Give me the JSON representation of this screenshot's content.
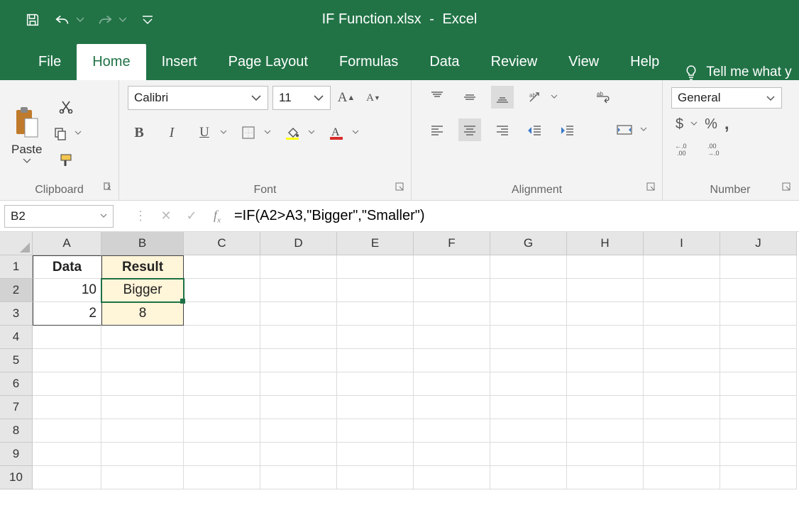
{
  "title": {
    "filename": "IF Function.xlsx",
    "separator": "-",
    "app": "Excel"
  },
  "tabs": [
    "File",
    "Home",
    "Insert",
    "Page Layout",
    "Formulas",
    "Data",
    "Review",
    "View",
    "Help"
  ],
  "active_tab": "Home",
  "tellme": "Tell me what y",
  "ribbon": {
    "clipboard": {
      "paste": "Paste",
      "label": "Clipboard"
    },
    "font": {
      "name": "Calibri",
      "size": "11",
      "bold": "B",
      "italic": "I",
      "underline": "U",
      "label": "Font"
    },
    "alignment": {
      "label": "Alignment"
    },
    "number": {
      "format": "General",
      "currency": "$",
      "percent": "%",
      "comma": ",",
      "inc_dec_label1": ".0",
      "inc_dec_label2": ".00",
      "label": "Number"
    }
  },
  "namebox": "B2",
  "formula": "=IF(A2>A3,\"Bigger\",\"Smaller\")",
  "columns": [
    "A",
    "B",
    "C",
    "D",
    "E",
    "F",
    "G",
    "H",
    "I",
    "J"
  ],
  "rows": [
    "1",
    "2",
    "3",
    "4",
    "5",
    "6",
    "7",
    "8",
    "9",
    "10"
  ],
  "cells": {
    "A1": "Data",
    "B1": "Result",
    "A2": "10",
    "B2": "Bigger",
    "A3": "2",
    "B3": "8"
  }
}
